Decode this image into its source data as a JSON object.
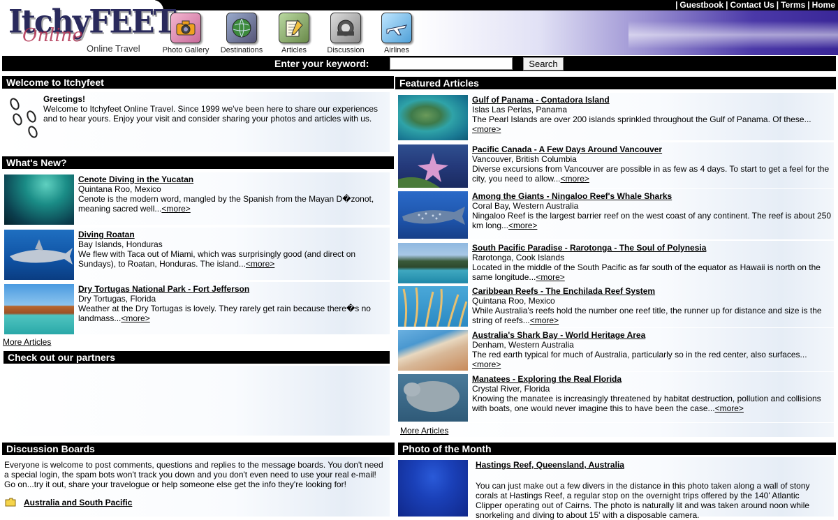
{
  "header": {
    "top_links": [
      "Guestbook",
      "Contact Us",
      "Terms",
      "Home"
    ],
    "logo_main": "ItchyFEET",
    "logo_script": "Online",
    "logo_sub": "Online Travel",
    "nav": [
      {
        "label": "Photo Gallery",
        "icon": "camera-icon"
      },
      {
        "label": "Destinations",
        "icon": "globe-icon"
      },
      {
        "label": "Articles",
        "icon": "notebook-icon"
      },
      {
        "label": "Discussion",
        "icon": "discussion-icon"
      },
      {
        "label": "Airlines",
        "icon": "airplane-icon"
      }
    ]
  },
  "search": {
    "label": "Enter your keyword:",
    "value": "",
    "placeholder": "",
    "button": "Search"
  },
  "welcome": {
    "heading": "Welcome to Itchyfeet",
    "greeting": "Greetings!",
    "text": "Welcome to Itchyfeet Online Travel. Since 1999 we've been here to share our experiences and to hear yours. Enjoy your visit and consider sharing your photos and articles with us."
  },
  "whats_new": {
    "heading": "What's New?",
    "items": [
      {
        "title": "Cenote Diving in the Yucatan",
        "location": "Quintana Roo, Mexico",
        "desc": "Cenote is the modern word, mangled by the Spanish from the Mayan D�zonot, meaning sacred well...",
        "more": "<more>"
      },
      {
        "title": "Diving Roatan",
        "location": "Bay Islands, Honduras",
        "desc": "We flew with Taca out of Miami, which was surprisingly good (and direct on Sundays), to Roatan, Honduras. The island...",
        "more": "<more>"
      },
      {
        "title": "Dry Tortugas National Park - Fort Jefferson",
        "location": "Dry Tortugas, Florida",
        "desc": "Weather at the Dry Tortugas is lovely. They rarely get rain because there�s no landmass...",
        "more": "<more>"
      }
    ],
    "more_link": "More Articles"
  },
  "partners": {
    "heading": "Check out our partners"
  },
  "featured": {
    "heading": "Featured Articles",
    "items": [
      {
        "title": "Gulf of Panama - Contadora Island",
        "location": "Islas Las Perlas, Panama",
        "desc": "The Pearl Islands are over 200 islands sprinkled throughout the Gulf of Panama. Of these...",
        "more": "<more>"
      },
      {
        "title": "Pacific Canada - A Few Days Around Vancouver",
        "location": "Vancouver, British Columbia",
        "desc": "Diverse excursions from Vancouver are possible in as few as 4 days. To start to get a feel for the city, you need to allow...",
        "more": "<more>"
      },
      {
        "title": "Among the Giants - Ningaloo Reef's Whale Sharks",
        "location": "Coral Bay, Western Australia",
        "desc": "Ningaloo Reef is the largest barrier reef on the west coast of any continent. The reef is about 250 km long...",
        "more": "<more>"
      },
      {
        "title": "South Pacific Paradise - Rarotonga - The Soul of Polynesia",
        "location": "Rarotonga, Cook Islands",
        "desc": "Located in the middle of the South Pacific as far south of the equator as Hawaii is north on the same longitude...",
        "more": "<more>"
      },
      {
        "title": "Caribbean Reefs - The Enchilada Reef System",
        "location": "Quintana Roo, Mexico",
        "desc": "While Australia's reefs hold the number one reef title, the runner up for distance and size is the string of reefs...",
        "more": "<more>"
      },
      {
        "title": "Australia's Shark Bay - World Heritage Area",
        "location": "Denham, Western Australia",
        "desc": "The red earth typical for much of Australia, particularly so in the red center, also surfaces...",
        "more": "<more>"
      },
      {
        "title": "Manatees - Exploring the Real Florida",
        "location": "Crystal River, Florida",
        "desc": "Knowing the manatee is increasingly threatened by habitat destruction, pollution and collisions with boats, one would never imagine this to have been the case...",
        "more": "<more>"
      }
    ],
    "more_link": "More Articles"
  },
  "discussion": {
    "heading": "Discussion Boards",
    "text": "Everyone is welcome to post comments, questions and replies to the message boards. You don't need a special login, the spam bots won't track you down and you don't even need to use your real e-mail! Go on...try it out, share your travelogue or help someone else get the info they're looking for!",
    "boards": [
      "Australia and South Pacific"
    ]
  },
  "photo_month": {
    "heading": "Photo of the Month",
    "title": "Hastings Reef, Queensland, Australia",
    "desc": "You can just make out a few divers in the distance in this photo taken along a wall of stony corals at Hastings Reef, a regular stop on the overnight trips offered by the 140' Atlantic Clipper operating out of Cairns. The photo is naturally lit and was taken around noon while snorkeling and diving to about 15' with a disposable camera."
  },
  "colors": {
    "bar": "#000000",
    "panel_fade": "#e6edf6",
    "header_purple": "#3a2798"
  }
}
